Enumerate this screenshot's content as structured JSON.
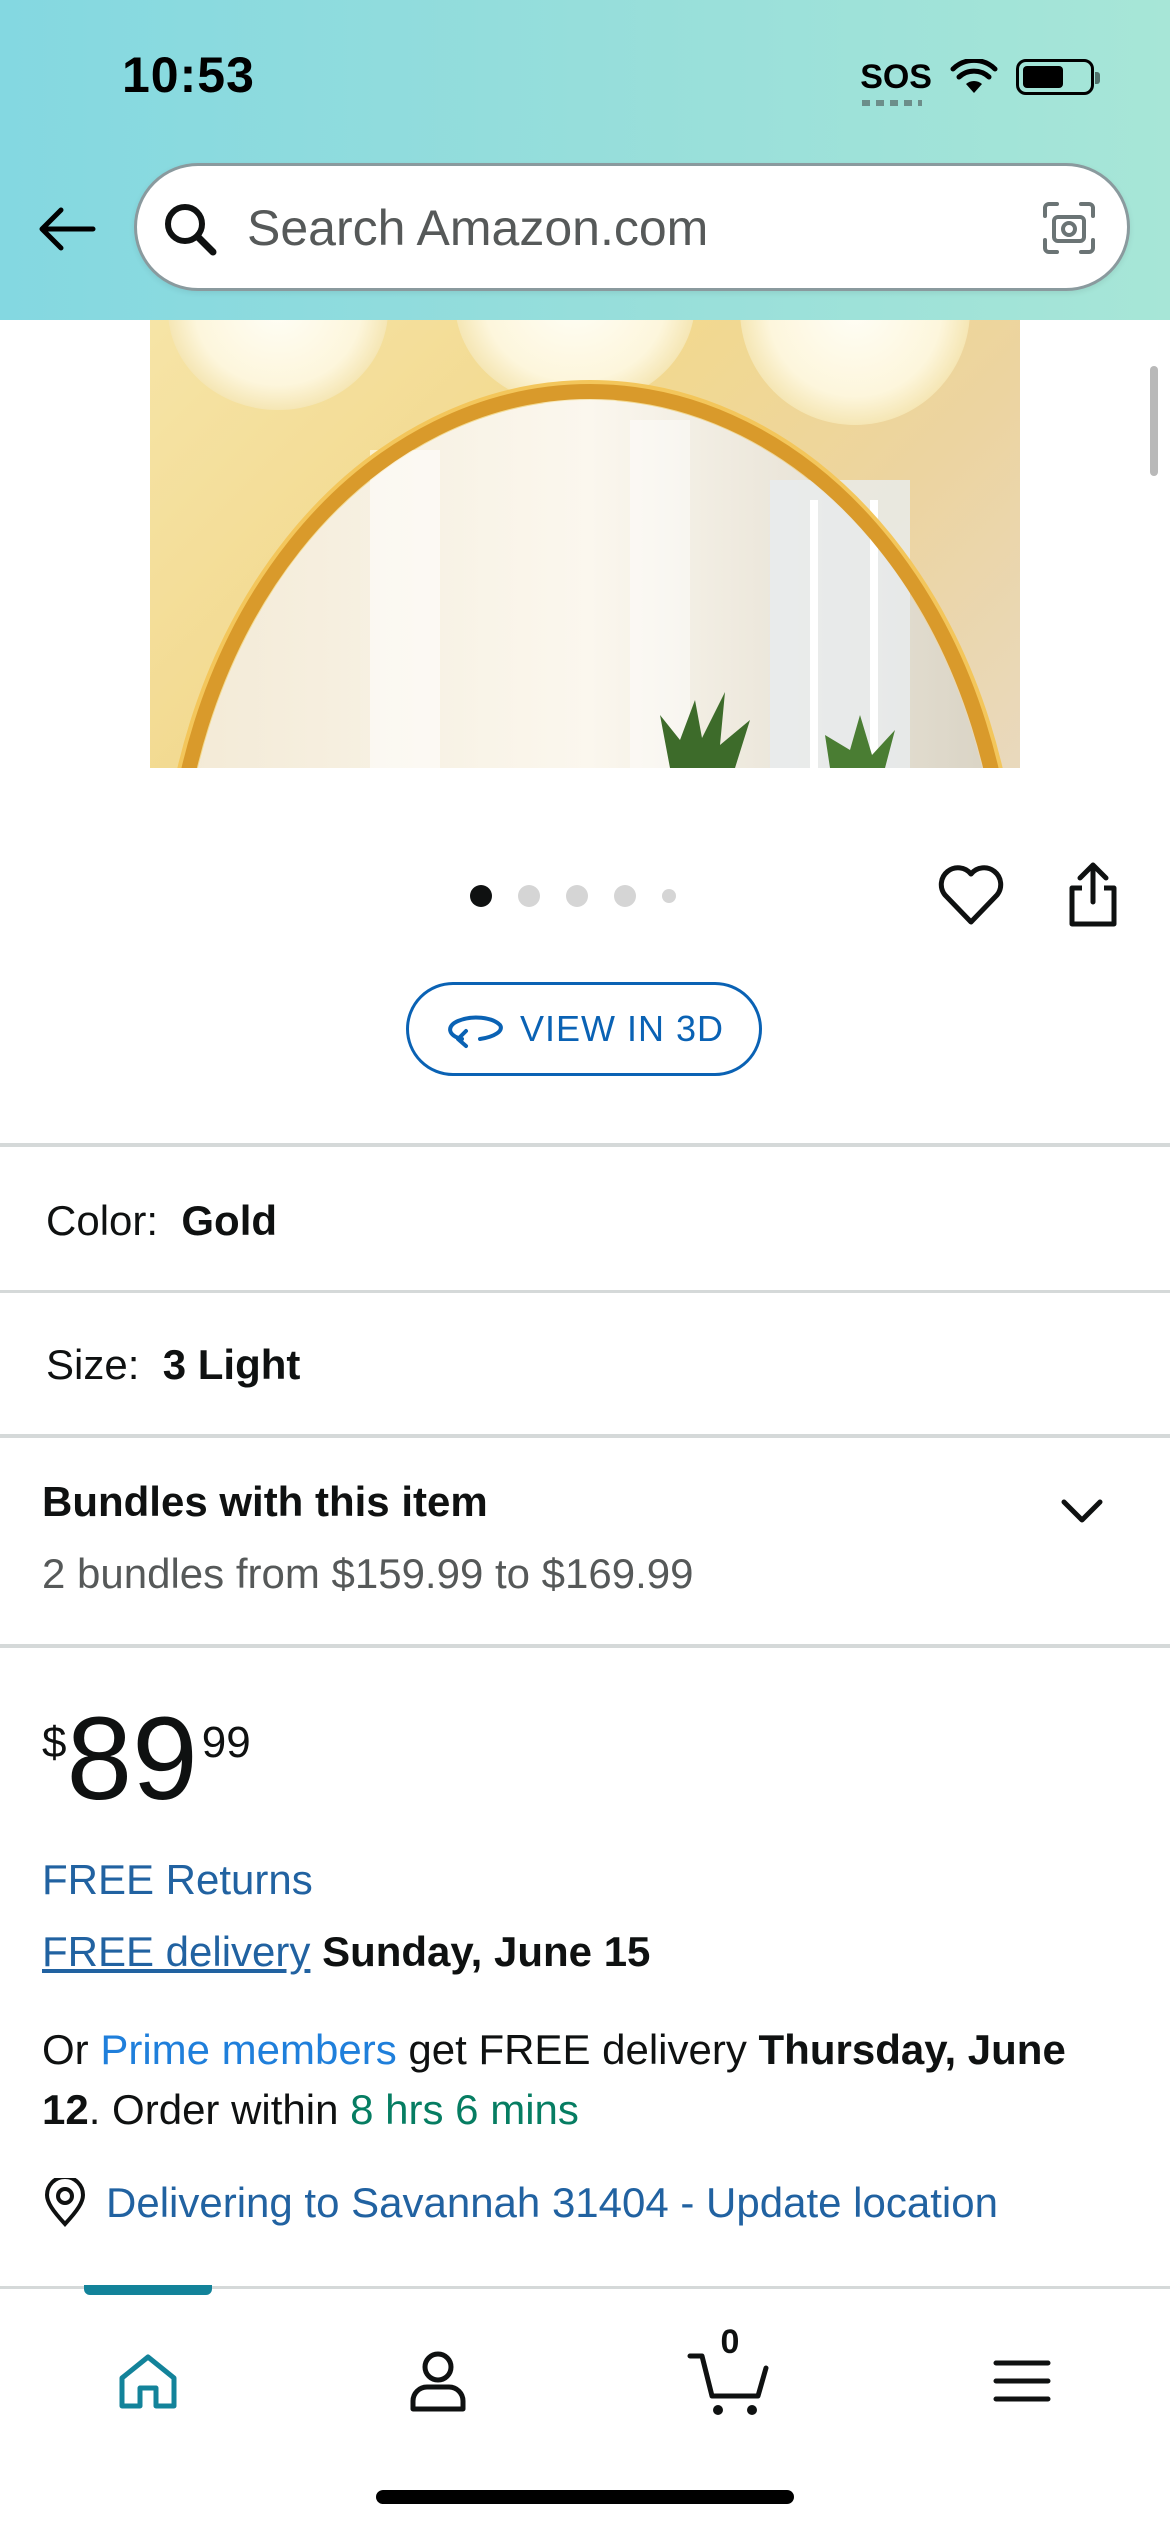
{
  "status_bar": {
    "time": "10:53",
    "sos": "SOS"
  },
  "search": {
    "placeholder": "Search Amazon.com"
  },
  "carousel": {
    "count": 5,
    "active_index": 0
  },
  "view_3d": {
    "label": "VIEW IN 3D"
  },
  "variations": {
    "color": {
      "label": "Color:",
      "value": "Gold"
    },
    "size": {
      "label": "Size:",
      "value": "3 Light"
    }
  },
  "bundles": {
    "title": "Bundles with this item",
    "subtitle": "2 bundles from $159.99 to $169.99"
  },
  "price": {
    "symbol": "$",
    "whole": "89",
    "fraction": "99"
  },
  "shipping": {
    "free_returns": "FREE Returns",
    "free_delivery_link": "FREE delivery",
    "free_delivery_date": "Sunday, June 15",
    "prime_prefix": "Or ",
    "prime_link": "Prime members",
    "prime_mid": " get FREE delivery ",
    "prime_date": "Thursday, June 12",
    "order_within_prefix": ". Order within ",
    "order_within_time": "8 hrs 6 mins",
    "deliver_to": "Delivering to Savannah 31404 - Update location"
  },
  "bottom_nav": {
    "cart_count": "0"
  },
  "colors": {
    "link": "#2162a1",
    "accent_teal": "#13839a",
    "green": "#067d62",
    "button_blue": "#0a62b4"
  }
}
